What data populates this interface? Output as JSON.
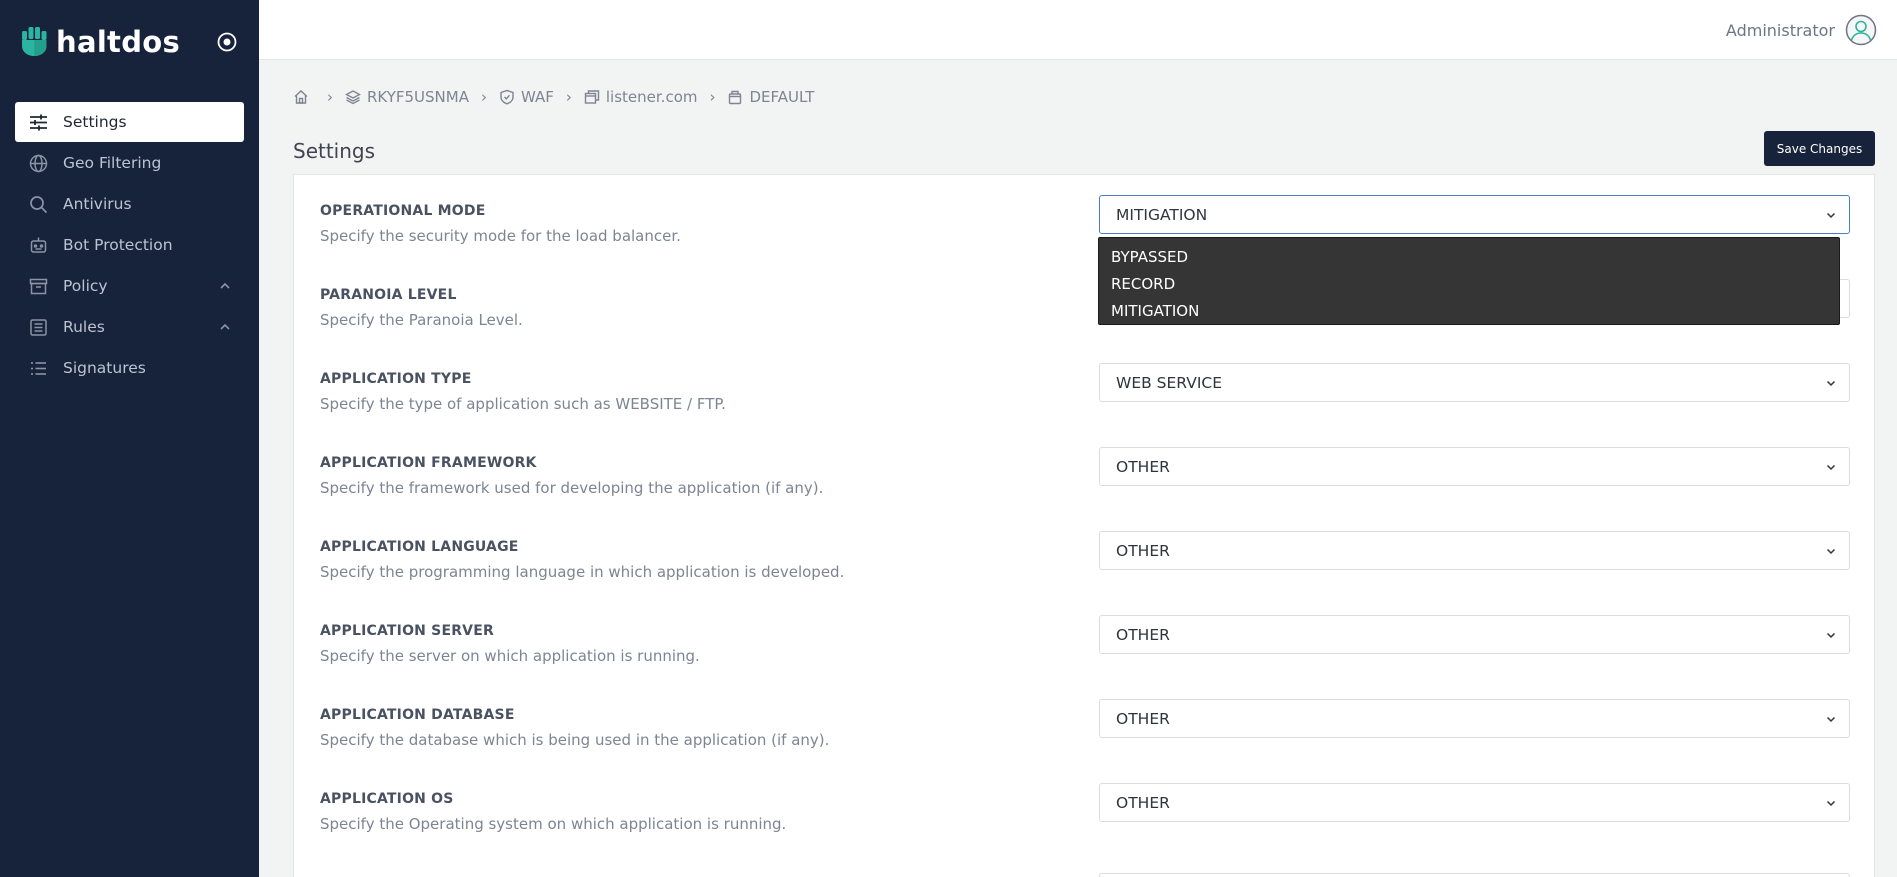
{
  "brand": {
    "name": "haltdos"
  },
  "colors": {
    "sidebar_bg": "#17223b",
    "accent": "#2bb5a0",
    "button_bg": "#17223b"
  },
  "sidebar": {
    "items": [
      {
        "label": "Settings",
        "icon": "sliders-icon",
        "active": true
      },
      {
        "label": "Geo Filtering",
        "icon": "globe-icon"
      },
      {
        "label": "Antivirus",
        "icon": "search-icon"
      },
      {
        "label": "Bot Protection",
        "icon": "robot-icon"
      },
      {
        "label": "Policy",
        "icon": "archive-icon",
        "expandable": true
      },
      {
        "label": "Rules",
        "icon": "list-box-icon",
        "expandable": true
      },
      {
        "label": "Signatures",
        "icon": "list-icon"
      }
    ]
  },
  "header": {
    "user_name": "Administrator"
  },
  "breadcrumb": {
    "items": [
      {
        "label": "RKYF5USNMA",
        "icon": "layers-icon"
      },
      {
        "label": "WAF",
        "icon": "shield-icon"
      },
      {
        "label": "listener.com",
        "icon": "window-icon"
      },
      {
        "label": "DEFAULT",
        "icon": "bucket-icon"
      }
    ],
    "separator": "›"
  },
  "page": {
    "title": "Settings",
    "save_label": "Save Changes"
  },
  "settings": [
    {
      "title": "OPERATIONAL MODE",
      "description": "Specify the security mode for the load balancer.",
      "value": "MITIGATION"
    },
    {
      "title": "PARANOIA LEVEL",
      "description": "Specify the Paranoia Level.",
      "value": ""
    },
    {
      "title": "APPLICATION TYPE",
      "description": "Specify the type of application such as WEBSITE / FTP.",
      "value": "WEB SERVICE"
    },
    {
      "title": "APPLICATION FRAMEWORK",
      "description": "Specify the framework used for developing the application (if any).",
      "value": "OTHER"
    },
    {
      "title": "APPLICATION LANGUAGE",
      "description": "Specify the programming language in which application is developed.",
      "value": "OTHER"
    },
    {
      "title": "APPLICATION SERVER",
      "description": "Specify the server on which application is running.",
      "value": "OTHER"
    },
    {
      "title": "APPLICATION DATABASE",
      "description": "Specify the database which is being used in the application (if any).",
      "value": "OTHER"
    },
    {
      "title": "APPLICATION OS",
      "description": "Specify the Operating system on which application is running.",
      "value": "OTHER"
    }
  ],
  "dropdown": {
    "options": [
      "BYPASSED",
      "RECORD",
      "MITIGATION"
    ]
  }
}
